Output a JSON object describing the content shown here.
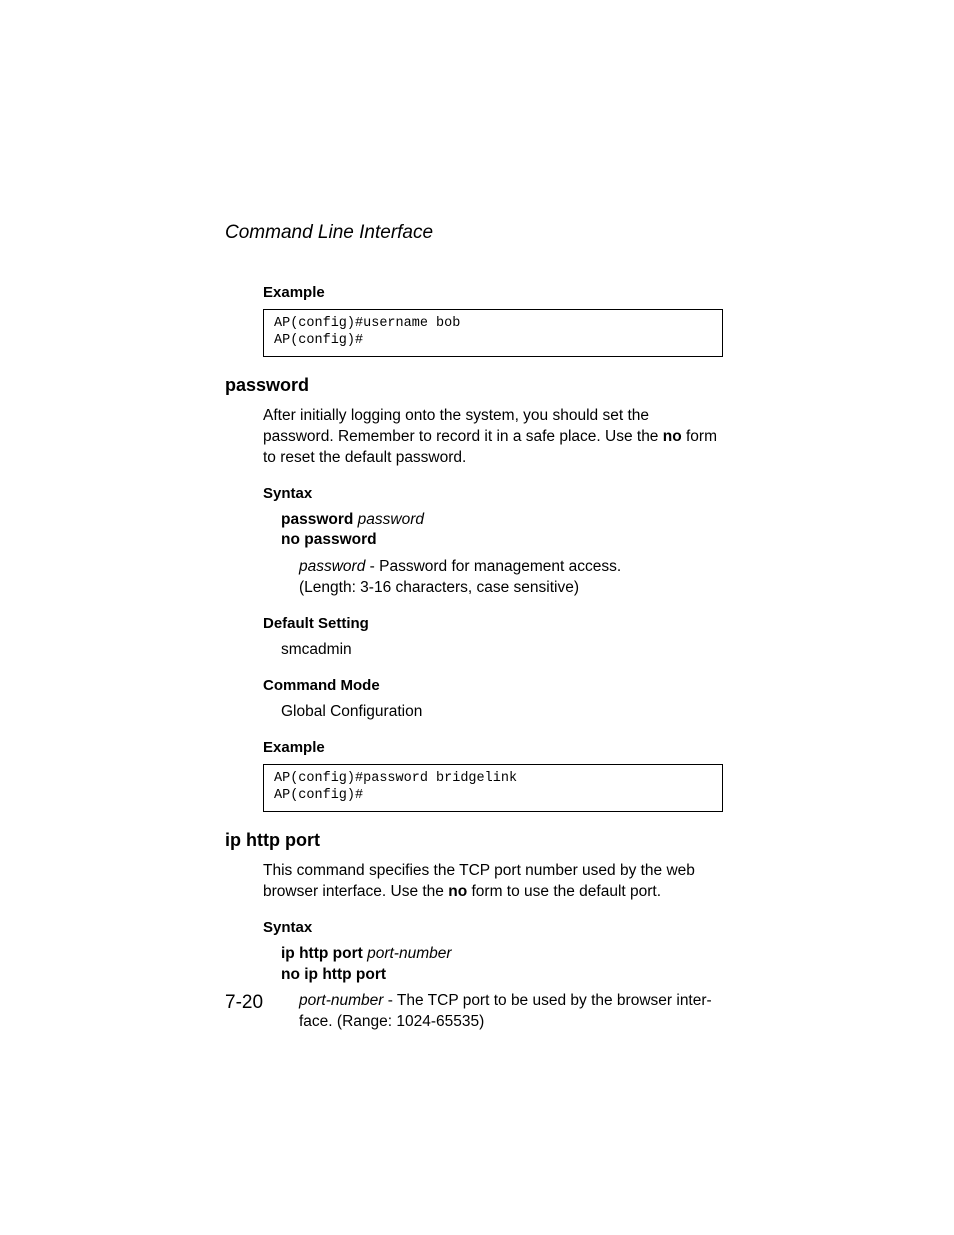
{
  "header": "Command Line Interface",
  "page_number": "7-20",
  "s0": {
    "example_label": "Example",
    "code_line1": "AP(config)#username bob",
    "code_line2": "AP(config)#"
  },
  "s1": {
    "title": "password",
    "intro_pre": "After initially logging onto the system, you should set the password. Remember to record it in a safe place. Use the ",
    "intro_bold": "no",
    "intro_post": " form to reset the default password.",
    "syntax_label": "Syntax",
    "syntax_cmd_bold": "password",
    "syntax_cmd_ital": "password",
    "syntax_no": "no password",
    "param_name": "password",
    "param_desc": " - Password for management access.",
    "param_note": "(Length: 3-16 characters, case sensitive)",
    "default_label": "Default Setting",
    "default_value": "smcadmin",
    "mode_label": "Command Mode",
    "mode_value": "Global Configuration",
    "example_label": "Example",
    "code_line1": "AP(config)#password bridgelink",
    "code_line2": "AP(config)#"
  },
  "s2": {
    "title": "ip http port",
    "intro_pre": "This command specifies the TCP port number used by the web browser interface. Use the ",
    "intro_bold": "no",
    "intro_post": " form to use the default port.",
    "syntax_label": "Syntax",
    "syntax_cmd_bold": "ip http port",
    "syntax_cmd_ital": "port-number",
    "syntax_no": "no ip http port",
    "param_name": "port-number",
    "param_desc": " - The TCP port to be used by the browser inter-",
    "param_desc2": "face. (Range: 1024-65535)"
  }
}
